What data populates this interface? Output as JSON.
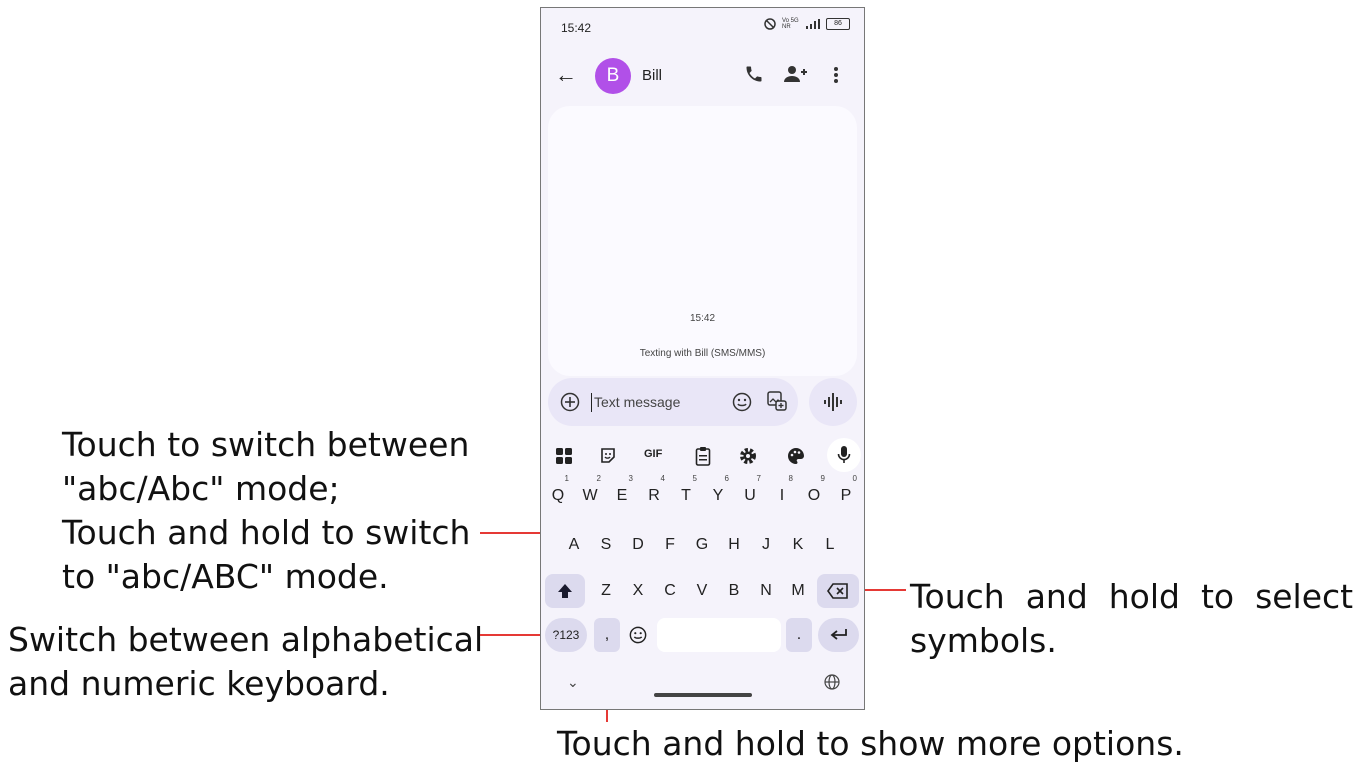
{
  "status_bar": {
    "time": "15:42",
    "battery": "86",
    "network": "Vo 5G NR"
  },
  "app_bar": {
    "avatar_letter": "B",
    "contact_name": "Bill"
  },
  "conversation": {
    "timestamp": "15:42",
    "info": "Texting with Bill (SMS/MMS)"
  },
  "compose": {
    "placeholder": "Text message"
  },
  "toolbar": {
    "gif_label": "GIF"
  },
  "keyboard": {
    "row1": [
      {
        "key": "Q",
        "hint": "1"
      },
      {
        "key": "W",
        "hint": "2"
      },
      {
        "key": "E",
        "hint": "3"
      },
      {
        "key": "R",
        "hint": "4"
      },
      {
        "key": "T",
        "hint": "5"
      },
      {
        "key": "Y",
        "hint": "6"
      },
      {
        "key": "U",
        "hint": "7"
      },
      {
        "key": "I",
        "hint": "8"
      },
      {
        "key": "O",
        "hint": "9"
      },
      {
        "key": "P",
        "hint": "0"
      }
    ],
    "row2": [
      "A",
      "S",
      "D",
      "F",
      "G",
      "H",
      "J",
      "K",
      "L"
    ],
    "row3": [
      "Z",
      "X",
      "C",
      "V",
      "B",
      "N",
      "M"
    ],
    "symbols_key": "?123",
    "comma_key": ",",
    "period_key": "."
  },
  "callouts": {
    "shift_line1": "Touch to switch between",
    "shift_line2": "\"abc/Abc\" mode;",
    "shift_line3": "Touch and hold to switch",
    "shift_line4": "to \"abc/ABC\" mode.",
    "numeric_line1": "Switch between alphabetical",
    "numeric_line2": "and numeric keyboard.",
    "symbols_line1": "Touch  and  hold  to  select",
    "symbols_line2": "symbols.",
    "options": "Touch and hold to show more options."
  },
  "colors": {
    "avatar": "#b150e8",
    "callout_line": "#e53935",
    "key_light": "#dcdaee",
    "screen_bg": "#f5f3fb"
  }
}
